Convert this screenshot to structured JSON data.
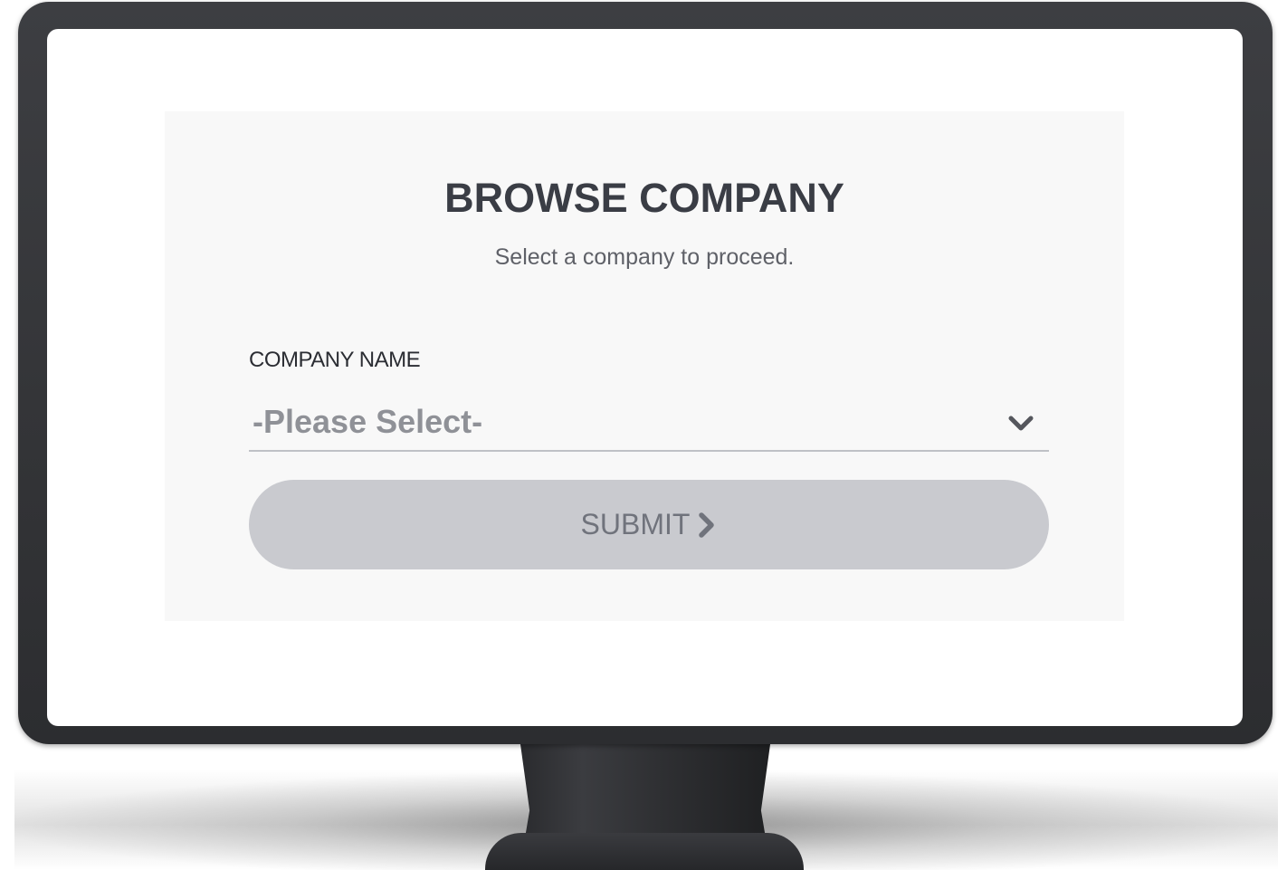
{
  "form": {
    "title": "BROWSE COMPANY",
    "subtitle": "Select a company to proceed.",
    "company_label": "COMPANY NAME",
    "company_select_value": "-Please Select-",
    "submit_label": "SUBMIT"
  },
  "icons": {
    "select_arrow": "chevron-down-icon",
    "submit_arrow": "chevron-right-icon"
  },
  "colors": {
    "bezel": "#333437",
    "panel_bg": "#f8f8f8",
    "button_bg": "#c9cacf",
    "title_text": "#3a3d45"
  }
}
